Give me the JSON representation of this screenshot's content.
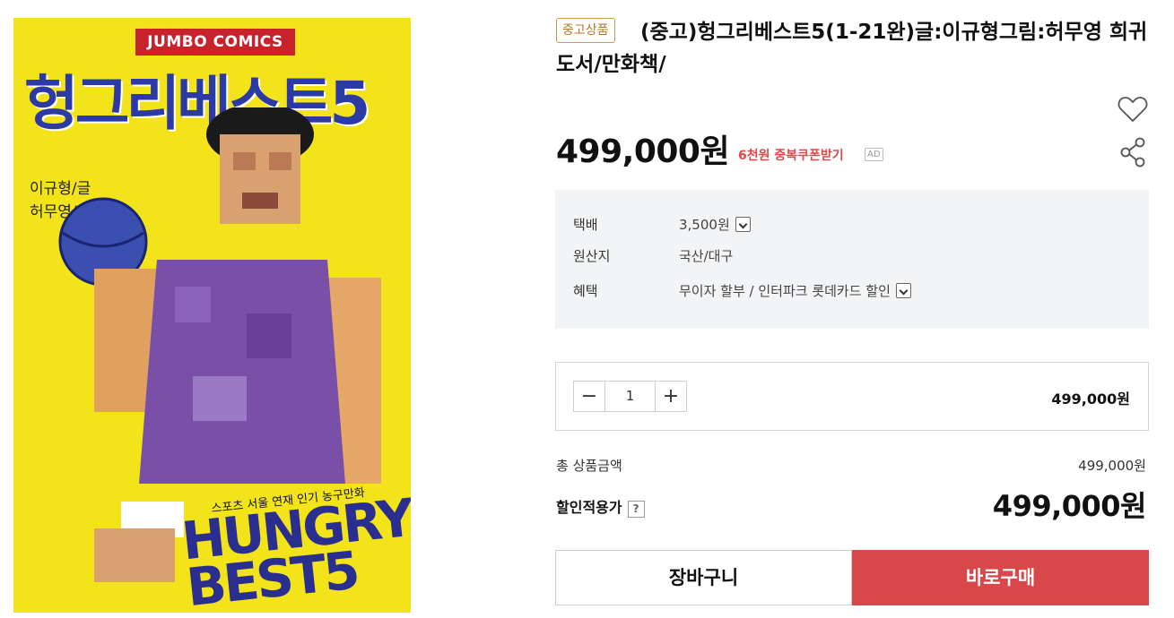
{
  "product_image": {
    "badge": "JUMBO COMICS",
    "title": "헝그리베스트5",
    "author_line1": "이규형/글",
    "author_line2": "허무영/그림",
    "subtitle": "스포츠 서울 연재 인기 농구만화",
    "english_title_line1": "HUNGRY",
    "english_title_line2": "BEST5",
    "colors": {
      "background": "#f2e31a",
      "title": "#2c3aa6",
      "badge": "#c8232c"
    }
  },
  "product": {
    "tag": "중고상품",
    "title": "(중고)헝그리베스트5(1-21완)글:이규형그림:허무영 희귀도서/만화책/",
    "price": "499,000원",
    "coupon": "6천원 중복쿠폰받기",
    "ad_label": "AD"
  },
  "actions": {
    "wishlist_icon": "heart-icon",
    "share_icon": "share-icon"
  },
  "info": {
    "shipping_label": "택배",
    "shipping_value": "3,500원",
    "origin_label": "원산지",
    "origin_value": "국산/대구",
    "benefit_label": "혜택",
    "benefit_value": "무이자 할부 / 인터파크 롯데카드 할인"
  },
  "quantity": {
    "minus": "−",
    "value": "1",
    "plus": "+",
    "line_price": "499,000원"
  },
  "summary": {
    "total_label": "총 상품금액",
    "total_value": "499,000원",
    "discount_label": "할인적용가",
    "help": "?",
    "discount_value": "499,000원"
  },
  "buttons": {
    "cart": "장바구니",
    "buy": "바로구매"
  },
  "theme": {
    "accent_red": "#d8484b",
    "coupon_red": "#e0484a",
    "tag_gold": "#b07a2a",
    "info_bg": "#f3f4f6"
  }
}
